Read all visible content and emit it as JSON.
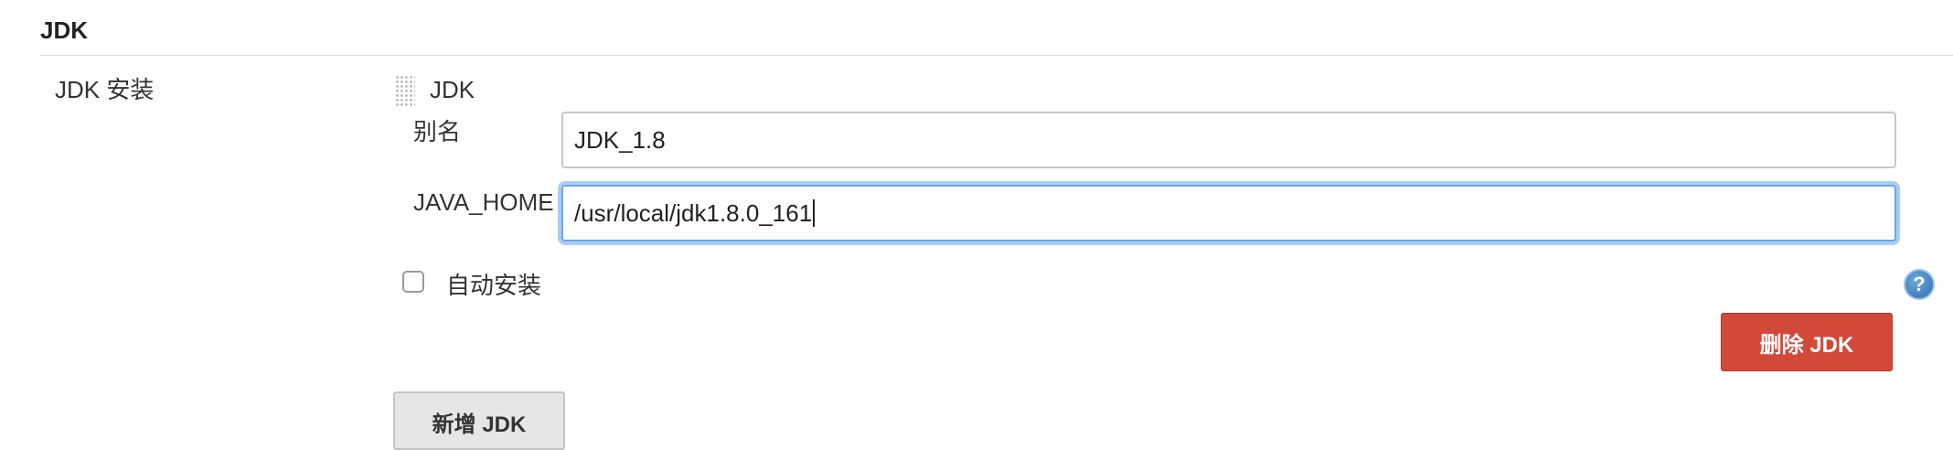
{
  "section": {
    "title": "JDK"
  },
  "setting": {
    "label": "JDK 安装"
  },
  "jdk_entry": {
    "title": "JDK",
    "alias": {
      "label": "别名",
      "value": "JDK_1.8"
    },
    "java_home": {
      "label": "JAVA_HOME",
      "value": "/usr/local/jdk1.8.0_161"
    },
    "auto_install": {
      "label": "自动安装",
      "checked": false
    },
    "delete_label": "删除 JDK"
  },
  "add_label": "新增 JDK",
  "icons": {
    "help": "help-icon",
    "drag": "drag-handle-icon"
  },
  "colors": {
    "delete_button": "#d24939",
    "focus_ring": "#6aa7e8",
    "help_icon": "#2f6fb0"
  }
}
